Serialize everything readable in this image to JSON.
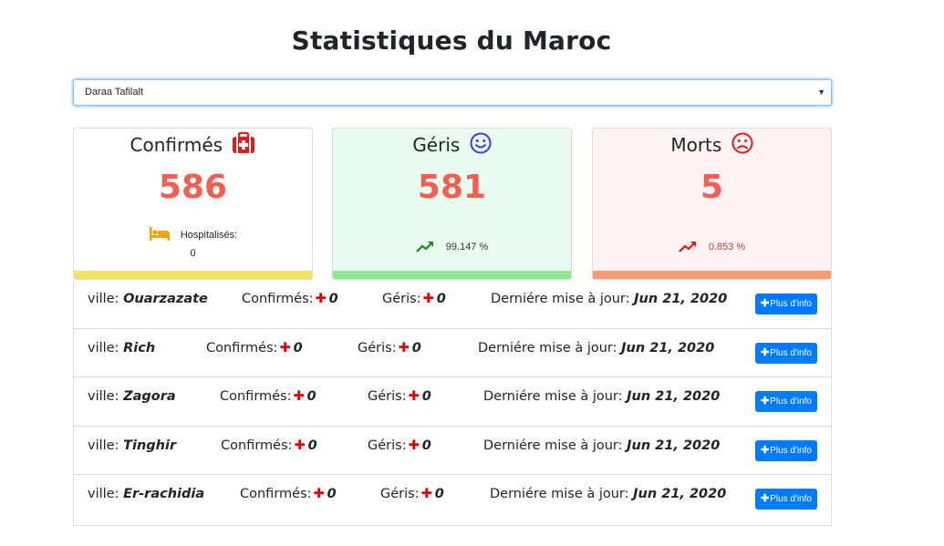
{
  "page": {
    "title": "Statistiques du Maroc"
  },
  "region_select": {
    "selected": "Daraa Tafilalt"
  },
  "cards": {
    "confirmed": {
      "label": "Confirmés",
      "value": "586",
      "hosp_label": "Hospitalisés:",
      "hosp_value": "0",
      "icon": "first-aid-kit-icon",
      "color": "#f7e45e"
    },
    "recovered": {
      "label": "Géris",
      "value": "581",
      "pct": "99.147 %",
      "icon": "smile-icon",
      "color": "#8fe88f"
    },
    "deaths": {
      "label": "Morts",
      "value": "5",
      "pct": "0.853 %",
      "icon": "frown-icon",
      "color": "#fb9a73"
    }
  },
  "labels": {
    "ville": "ville:",
    "confirmes": "Confirmés:",
    "geris": "Géris:",
    "maj": "Derniére mise à jour:",
    "info_button": "Plus d'info"
  },
  "cities": [
    {
      "name": "Ouarzazate",
      "confirmed": "0",
      "recovered": "0",
      "date": "Jun 21, 2020"
    },
    {
      "name": "Rich",
      "confirmed": "0",
      "recovered": "0",
      "date": "Jun 21, 2020"
    },
    {
      "name": "Zagora",
      "confirmed": "0",
      "recovered": "0",
      "date": "Jun 21, 2020"
    },
    {
      "name": "Tinghir",
      "confirmed": "0",
      "recovered": "0",
      "date": "Jun 21, 2020"
    },
    {
      "name": "Er-rachidia",
      "confirmed": "0",
      "recovered": "0",
      "date": "Jun 21, 2020"
    }
  ]
}
